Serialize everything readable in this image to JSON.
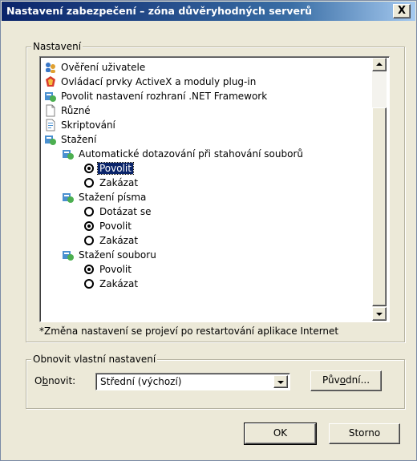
{
  "window": {
    "title": "Nastavení zabezpečení – zóna důvěryhodných serverů",
    "close_label": "X"
  },
  "settings_group": {
    "legend": "Nastavení",
    "items": [
      {
        "label": "Ověření uživatele",
        "icon": "user-auth-icon"
      },
      {
        "label": "Ovládací prvky ActiveX a moduly plug-in",
        "icon": "activex-icon"
      },
      {
        "label": "Povolit nastavení rozhraní .NET Framework",
        "icon": "settings-icon"
      },
      {
        "label": "Různé",
        "icon": "document-icon"
      },
      {
        "label": "Skriptování",
        "icon": "script-icon"
      },
      {
        "label": "Stažení",
        "icon": "settings-icon"
      },
      {
        "label": "Automatické dotazování při stahování souborů",
        "icon": "settings-icon"
      },
      {
        "label": "Povolit",
        "type": "radio",
        "checked": true,
        "selected": true
      },
      {
        "label": "Zakázat",
        "type": "radio",
        "checked": false
      },
      {
        "label": "Stažení písma",
        "icon": "settings-icon"
      },
      {
        "label": "Dotázat se",
        "type": "radio",
        "checked": false
      },
      {
        "label": "Povolit",
        "type": "radio",
        "checked": true
      },
      {
        "label": "Zakázat",
        "type": "radio",
        "checked": false
      },
      {
        "label": "Stažení souboru",
        "icon": "settings-icon"
      },
      {
        "label": "Povolit",
        "type": "radio",
        "checked": true
      },
      {
        "label": "Zakázat",
        "type": "radio",
        "checked": false
      }
    ],
    "note": "*Změna nastavení se projeví po restartování aplikace Internet"
  },
  "reset_group": {
    "legend": "Obnovit vlastní nastavení",
    "reset_label_prefix": "O",
    "reset_label_accel": "b",
    "reset_label_suffix": "novit:",
    "combo_value": "Střední (výchozí)",
    "reset_button_prefix": "Pův",
    "reset_button_accel": "o",
    "reset_button_suffix": "dní..."
  },
  "footer": {
    "ok_label": "OK",
    "cancel_label": "Storno"
  },
  "colors": {
    "title_start": "#0a246a",
    "title_end": "#a6caf0",
    "selection": "#0a246a",
    "face": "#ece9d8"
  }
}
